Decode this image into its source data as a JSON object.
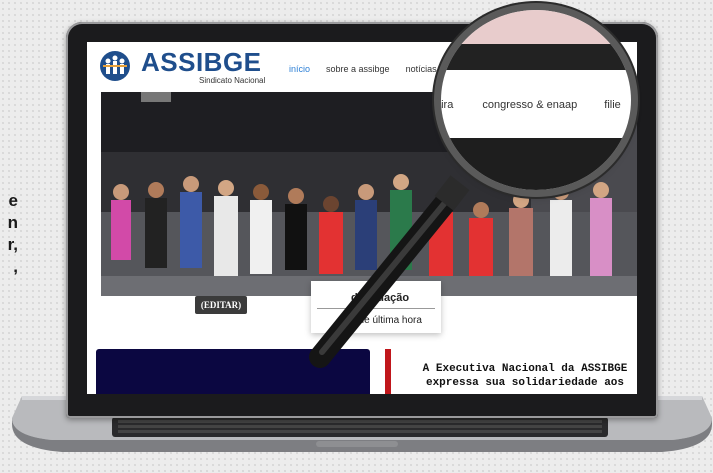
{
  "left_text": [
    "e",
    "n",
    "r,",
    ","
  ],
  "site": {
    "brand": "ASSIBGE",
    "brand_sub": "Sindicato Nacional",
    "nav": [
      "início",
      "sobre a assibge",
      "notícias",
      "n"
    ]
  },
  "hero": {
    "edit_button": "(EDITAR)"
  },
  "dropdown": {
    "item1": "da redação",
    "item2": "ias de última hora"
  },
  "news_text": "A Executiva Nacional da ASSIBGE expressa sua solidariedade aos",
  "magnifier": {
    "nav": [
      "eira",
      "congresso & enaap",
      "filie"
    ]
  },
  "colors": {
    "brand_blue": "#1f4e8c",
    "nav_active": "#2c7fd6",
    "accent_red": "#c0161b",
    "dark_card": "#0b0741"
  }
}
